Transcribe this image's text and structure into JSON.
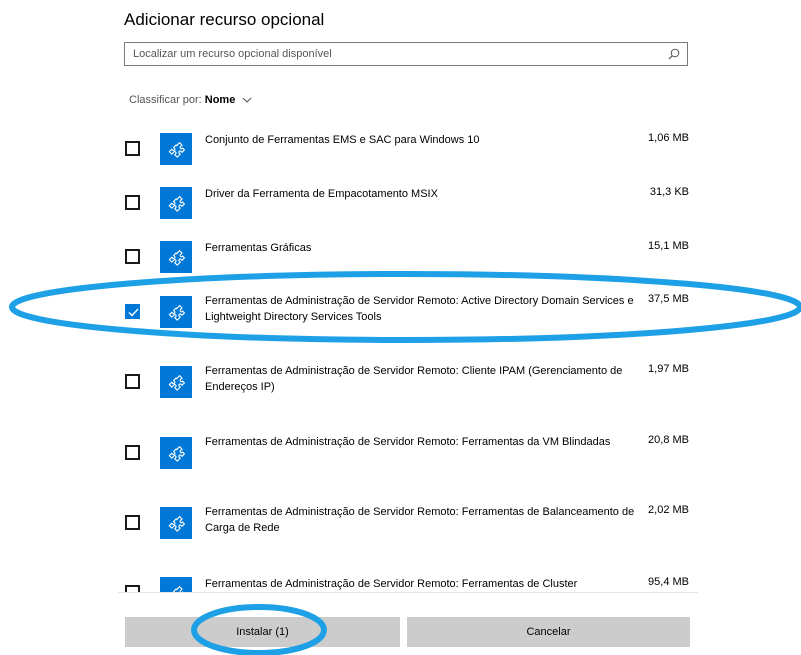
{
  "dialog": {
    "title": "Adicionar recurso opcional"
  },
  "search": {
    "placeholder": "Localizar um recurso opcional disponível",
    "icon": "search-icon"
  },
  "sort": {
    "label": "Classificar por:",
    "value": "Nome",
    "icon": "chevron-down-icon"
  },
  "features": [
    {
      "name": "Conjunto de Ferramentas EMS e SAC para Windows 10",
      "size": "1,06 MB",
      "checked": false
    },
    {
      "name": "Driver da Ferramenta de Empacotamento MSIX",
      "size": "31,3 KB",
      "checked": false
    },
    {
      "name": "Ferramentas Gráficas",
      "size": "15,1 MB",
      "checked": false
    },
    {
      "name": "Ferramentas de Administração de Servidor Remoto: Active Directory Domain Services e Lightweight Directory Services Tools",
      "size": "37,5 MB",
      "checked": true
    },
    {
      "name": "Ferramentas de Administração de Servidor Remoto: Cliente IPAM (Gerenciamento de Endereços IP)",
      "size": "1,97 MB",
      "checked": false
    },
    {
      "name": "Ferramentas de Administração de Servidor Remoto: Ferramentas da VM Blindadas",
      "size": "20,8 MB",
      "checked": false
    },
    {
      "name": "Ferramentas de Administração de Servidor Remoto: Ferramentas de Balanceamento de Carga de Rede",
      "size": "2,02 MB",
      "checked": false
    },
    {
      "name": "Ferramentas de Administração de Servidor Remoto: Ferramentas de Cluster",
      "size": "95,4 MB",
      "checked": false
    }
  ],
  "footer": {
    "install_label": "Instalar (1)",
    "cancel_label": "Cancelar"
  },
  "colors": {
    "accent": "#0078d7",
    "highlight": "#1ea0e6",
    "button": "#cccccc"
  }
}
